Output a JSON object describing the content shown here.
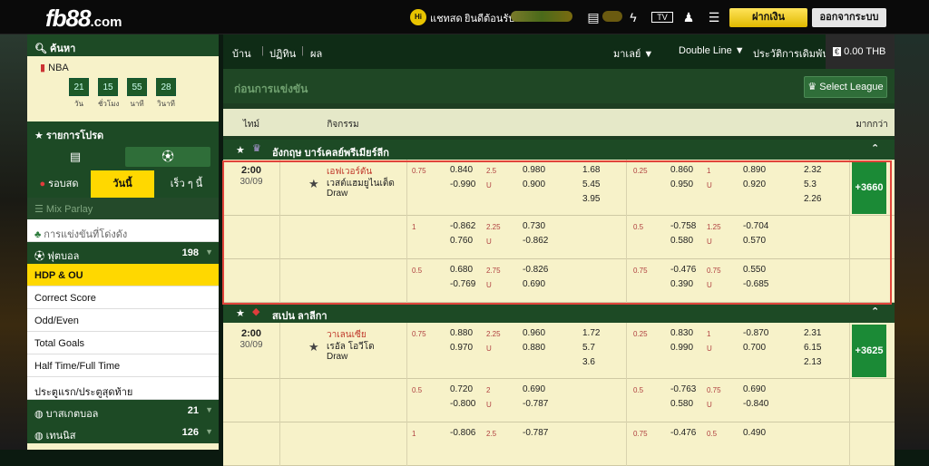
{
  "top": {
    "logo": "fb88",
    "logo_suffix": ".com",
    "chat": "แชทสด",
    "welcome": "ยินดีต้อนรับ",
    "deposit": "ฝากเงิน",
    "logout": "ออกจากระบบ"
  },
  "sidebar": {
    "search": "ค้นหา",
    "nba": "NBA",
    "timer": [
      {
        "v": "21",
        "l": "วัน"
      },
      {
        "v": "15",
        "l": "ชั่วโมง"
      },
      {
        "v": "55",
        "l": "นาที"
      },
      {
        "v": "28",
        "l": "วินาที"
      }
    ],
    "favorites": "รายการโปรด",
    "tabs": [
      "รอบสด",
      "วันนี้",
      "เร็ว ๆ นี้"
    ],
    "mix_parlay": "Mix Parlay",
    "outright": "การแข่งขันที่โด่งดัง",
    "football": "ฟุตบอล",
    "football_count": "198",
    "subs": [
      "HDP & OU",
      "Correct Score",
      "Odd/Even",
      "Total Goals",
      "Half Time/Full Time",
      "ประตูแรก/ประตูสุดท้าย"
    ],
    "basketball": "บาสเกตบอล",
    "basketball_count": "21",
    "tennis": "เทนนิส",
    "tennis_count": "126"
  },
  "nav": {
    "home": "บ้าน",
    "calendar": "ปฏิทิน",
    "results": "ผล",
    "lang": "มาเลย์ ▼",
    "line": "Double Line ▼",
    "history": "ประวัติการเดิมพัน",
    "balance": "0.00 THB"
  },
  "pre": {
    "title": "ก่อนการแข่งขัน",
    "select": "Select League"
  },
  "cols": {
    "time": "ไทม์",
    "event": "กิจกรรม",
    "more": "มากกว่า"
  },
  "leagues": [
    {
      "name": "อังกฤษ บาร์เคลย์พรีเมียร์ลีก",
      "time": "2:00",
      "date": "30/09",
      "home": "เอฟเวอร์ตัน",
      "away": "เวสต์แฮมยูไนเต็ด",
      "draw": "Draw",
      "more": "+3660",
      "rows": [
        {
          "h1": "0.75",
          "a": "0.840",
          "b": "-0.990",
          "ou": "2.5",
          "u": "U",
          "c": "0.980",
          "d": "0.900",
          "x1": [
            "1.68",
            "5.45",
            "3.95"
          ],
          "h2": "0.25",
          "e": "0.860",
          "f": "0.950",
          "ou2": "1",
          "u2": "U",
          "g": "0.890",
          "hh": "0.920",
          "x2": [
            "2.32",
            "5.3",
            "2.26"
          ]
        },
        {
          "h1": "1",
          "a": "-0.862",
          "b": "0.760",
          "ou": "2.25",
          "u": "U",
          "c": "0.730",
          "d": "-0.862",
          "x1": [],
          "h2": "0.5",
          "e": "-0.758",
          "f": "0.580",
          "ou2": "1.25",
          "u2": "U",
          "g": "-0.704",
          "hh": "0.570",
          "x2": []
        },
        {
          "h1": "0.5",
          "a": "0.680",
          "b": "-0.769",
          "ou": "2.75",
          "u": "U",
          "c": "-0.826",
          "d": "0.690",
          "x1": [],
          "h2": "0.75",
          "e": "-0.476",
          "f": "0.390",
          "ou2": "0.75",
          "u2": "U",
          "g": "0.550",
          "hh": "-0.685",
          "x2": []
        }
      ]
    },
    {
      "name": "สเปน ลาลีกา",
      "time": "2:00",
      "date": "30/09",
      "home": "วาเลนเซีย",
      "away": "เรอัล โอวีโด",
      "draw": "Draw",
      "more": "+3625",
      "rows": [
        {
          "h1": "0.75",
          "a": "0.880",
          "b": "0.970",
          "ou": "2.25",
          "u": "U",
          "c": "0.960",
          "d": "0.880",
          "x1": [
            "1.72",
            "5.7",
            "3.6"
          ],
          "h2": "0.25",
          "e": "0.830",
          "f": "0.990",
          "ou2": "1",
          "u2": "U",
          "g": "-0.870",
          "hh": "0.700",
          "x2": [
            "2.31",
            "6.15",
            "2.13"
          ]
        },
        {
          "h1": "0.5",
          "a": "0.720",
          "b": "-0.800",
          "ou": "2",
          "u": "U",
          "c": "0.690",
          "d": "-0.787",
          "x1": [],
          "h2": "0.5",
          "e": "-0.763",
          "f": "0.580",
          "ou2": "0.75",
          "u2": "U",
          "g": "0.690",
          "hh": "-0.840",
          "x2": []
        },
        {
          "h1": "1",
          "a": "-0.806",
          "b": "",
          "ou": "2.5",
          "u": "",
          "c": "-0.787",
          "d": "",
          "x1": [],
          "h2": "0.75",
          "e": "-0.476",
          "f": "",
          "ou2": "0.5",
          "u2": "",
          "g": "0.490",
          "hh": "",
          "x2": []
        }
      ]
    }
  ]
}
